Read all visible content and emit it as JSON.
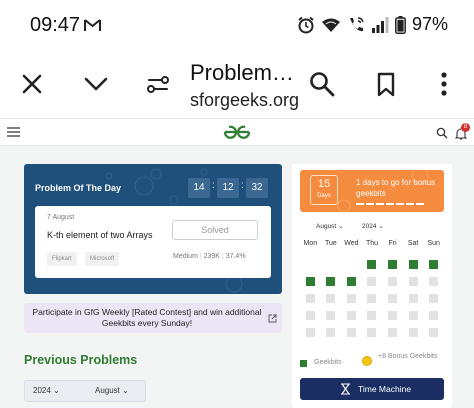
{
  "status_bar": {
    "time": "09:47",
    "battery_percent": "97%"
  },
  "browser": {
    "title": "Problem…",
    "url": "sforgeeks.org"
  },
  "potd": {
    "heading": "Problem Of The Day",
    "timer": {
      "hours": "14",
      "minutes": "12",
      "seconds": "32"
    },
    "date": "7 August",
    "problem_name": "K-th element of two Arrays",
    "status_label": "Solved",
    "tags": [
      "Flipkart",
      "Microsoft"
    ],
    "difficulty": "Medium",
    "submissions": "239K",
    "accuracy": "37.4%"
  },
  "weekly_banner": {
    "text": "Participate in GfG Weekly [Rated Contest] and win additional Geekbits every Sunday!"
  },
  "previous_problems": {
    "heading": "Previous Problems",
    "year": "2024",
    "month": "August"
  },
  "streak": {
    "count": "15",
    "unit": "Days",
    "message": "1 days to go for bonus geekbits",
    "progress_segments_done": 7,
    "progress_segments_total": 7
  },
  "calendar": {
    "month": "August",
    "year": "2024",
    "weekdays": [
      "Mon",
      "Tue",
      "Wed",
      "Thu",
      "Fri",
      "Sat",
      "Sun"
    ],
    "cells": [
      "empty",
      "empty",
      "empty",
      "done",
      "done",
      "done",
      "done",
      "done",
      "done",
      "done",
      "none",
      "none",
      "none",
      "none",
      "none",
      "none",
      "none",
      "none",
      "none",
      "none",
      "none",
      "none",
      "none",
      "none",
      "none",
      "none",
      "none",
      "none",
      "none",
      "none",
      "none",
      "none",
      "none",
      "none",
      "none"
    ]
  },
  "legend": {
    "geekbits": "Geekbits",
    "bonus": "+8 Bonus Geekbits"
  },
  "time_machine": {
    "label": "Time Machine"
  },
  "colors": {
    "potd_bg": "#1f4f7b",
    "gfg_green": "#2f7d32",
    "streak_orange": "#f48b3e",
    "time_machine_bg": "#1a2e63"
  }
}
